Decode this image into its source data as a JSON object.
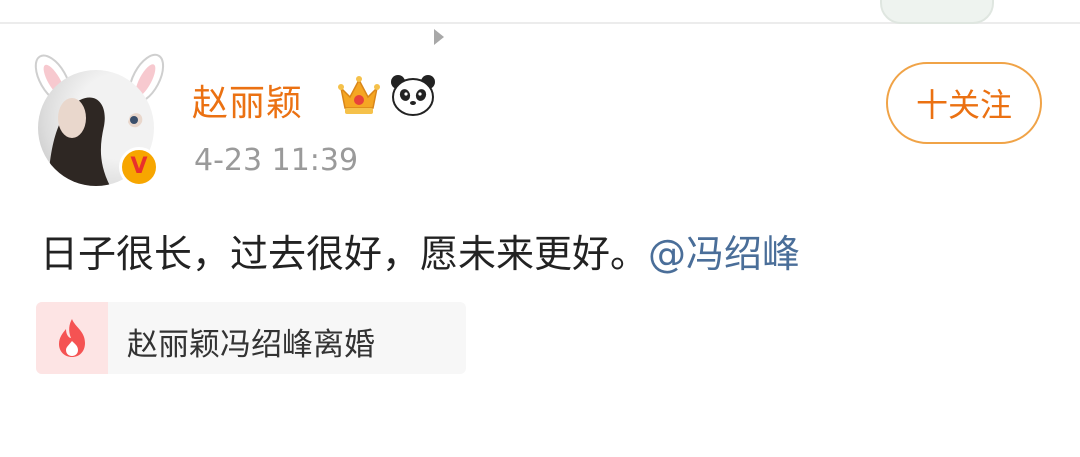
{
  "post": {
    "author": {
      "name": "赵丽颖",
      "verified_badge": "V",
      "badges": [
        "crown-icon",
        "panda-icon"
      ]
    },
    "timestamp": "4-23 11:39",
    "follow_label": "十关注",
    "text": "日子很长，过去很好，愿未来更好。",
    "mention": "@冯绍峰",
    "topic": {
      "label": "赵丽颖冯绍峰离婚",
      "icon": "fire-icon"
    }
  },
  "colors": {
    "username": "#eb7112",
    "follow_border": "#f0a347",
    "mention": "#4a6e99",
    "topic_icon_bg": "#fde4e4",
    "fire": "#f55353"
  }
}
